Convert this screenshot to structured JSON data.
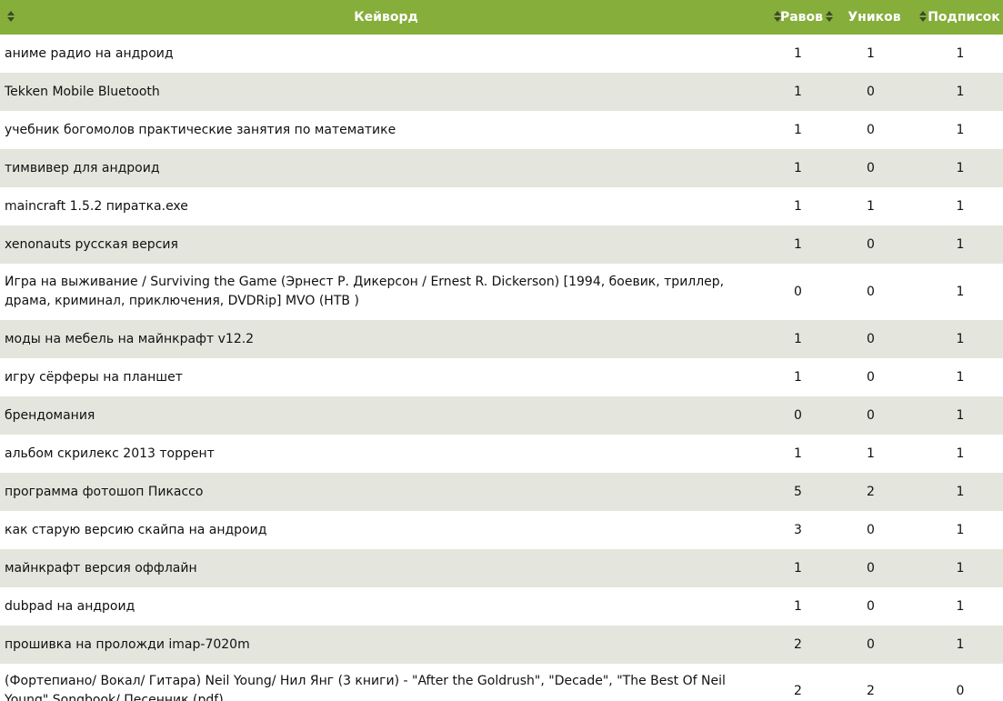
{
  "table": {
    "headers": {
      "keyword": "Кейворд",
      "raw": "Равов",
      "unique": "Уников",
      "subs": "Подписок"
    },
    "header_color": "#86ae3a",
    "stripe_color": "#e4e6dd",
    "rows": [
      {
        "keyword": "аниме радио на андроид",
        "raw": "1",
        "unique": "1",
        "subs": "1"
      },
      {
        "keyword": "Tekken Mobile Bluetooth",
        "raw": "1",
        "unique": "0",
        "subs": "1"
      },
      {
        "keyword": "учебник богомолов практические занятия по математике",
        "raw": "1",
        "unique": "0",
        "subs": "1"
      },
      {
        "keyword": "тимвивер для андроид",
        "raw": "1",
        "unique": "0",
        "subs": "1"
      },
      {
        "keyword": "maincraft 1.5.2 пиратка.exe",
        "raw": "1",
        "unique": "1",
        "subs": "1"
      },
      {
        "keyword": "xenonauts русская версия",
        "raw": "1",
        "unique": "0",
        "subs": "1"
      },
      {
        "keyword": "Игра на выживание / Surviving the Game (Эрнест Р. Дикерсон / Ernest R. Dickerson) [1994, боевик, триллер, драма, криминал, приключения, DVDRip] MVO (НТВ )",
        "raw": "0",
        "unique": "0",
        "subs": "1"
      },
      {
        "keyword": "моды на мебель на майнкрафт v12.2",
        "raw": "1",
        "unique": "0",
        "subs": "1"
      },
      {
        "keyword": "игру сёрферы на планшет",
        "raw": "1",
        "unique": "0",
        "subs": "1"
      },
      {
        "keyword": "брендомания",
        "raw": "0",
        "unique": "0",
        "subs": "1"
      },
      {
        "keyword": "альбом скрилекс 2013 торрент",
        "raw": "1",
        "unique": "1",
        "subs": "1"
      },
      {
        "keyword": "программа фотошоп Пикассо",
        "raw": "5",
        "unique": "2",
        "subs": "1"
      },
      {
        "keyword": "как старую версию скайпа на андроид",
        "raw": "3",
        "unique": "0",
        "subs": "1"
      },
      {
        "keyword": "майнкрафт версия оффлайн",
        "raw": "1",
        "unique": "0",
        "subs": "1"
      },
      {
        "keyword": "dubpad на андроид",
        "raw": "1",
        "unique": "0",
        "subs": "1"
      },
      {
        "keyword": "прошивка на проложди imap-7020m",
        "raw": "2",
        "unique": "0",
        "subs": "1"
      },
      {
        "keyword": "(Фортепиано/ Вокал/ Гитара) Neil Young/ Нил Янг (3 книги) - \"After the Goldrush\", \"Decade\", \"The Best Of Neil Young\" Songbook/ Песенник (pdf)",
        "raw": "2",
        "unique": "2",
        "subs": "0"
      }
    ]
  },
  "icons": {
    "sort": "sort-arrows-icon"
  }
}
